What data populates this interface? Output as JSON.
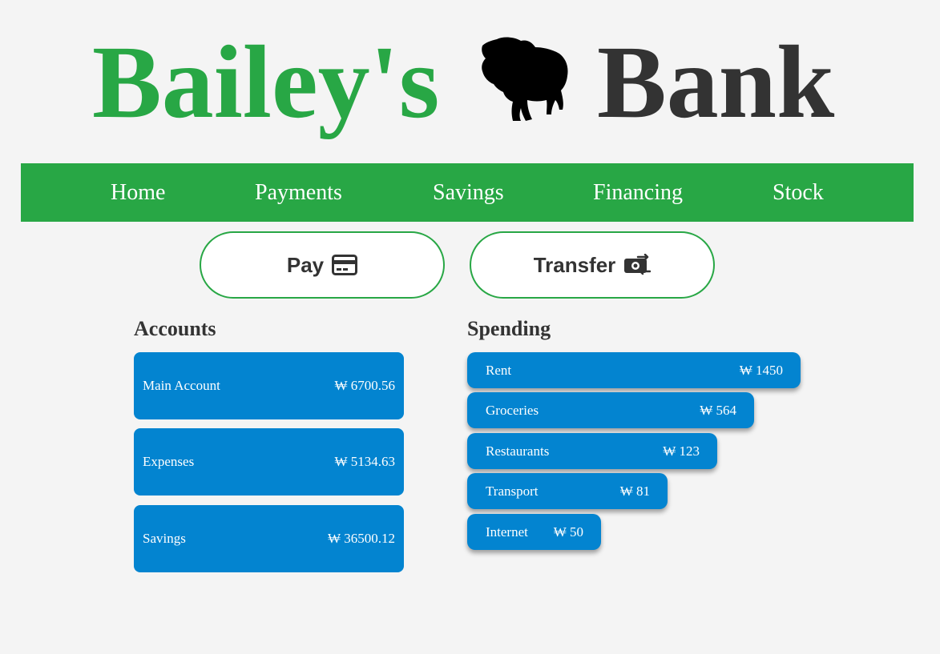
{
  "header": {
    "title_left": "Bailey's",
    "title_right": "Bank",
    "logo_icon": "bulldog-silhouette",
    "colors": {
      "brand_green": "#28a745",
      "dark_text": "#333333"
    }
  },
  "nav": {
    "items": [
      {
        "label": "Home"
      },
      {
        "label": "Payments"
      },
      {
        "label": "Savings"
      },
      {
        "label": "Financing"
      },
      {
        "label": "Stock"
      }
    ]
  },
  "actions": {
    "pay_label": "Pay",
    "pay_icon": "credit-card-icon",
    "transfer_label": "Transfer",
    "transfer_icon": "money-transfer-icon"
  },
  "accounts": {
    "title": "Accounts",
    "items": [
      {
        "name": "Main Account",
        "amount": "₩ 6700.56"
      },
      {
        "name": "Expenses",
        "amount": "₩ 5134.63"
      },
      {
        "name": "Savings",
        "amount": "₩ 36500.12"
      }
    ]
  },
  "spending": {
    "title": "Spending",
    "items": [
      {
        "name": "Rent",
        "amount": "₩ 1450",
        "value": 1450
      },
      {
        "name": "Groceries",
        "amount": "₩ 564",
        "value": 564
      },
      {
        "name": "Restaurants",
        "amount": "₩ 123",
        "value": 123
      },
      {
        "name": "Transport",
        "amount": "₩ 81",
        "value": 81
      },
      {
        "name": "Internet",
        "amount": "₩ 50",
        "value": 50
      }
    ]
  },
  "colors": {
    "accent_blue": "#0384d0",
    "background": "#f4f4f4"
  }
}
